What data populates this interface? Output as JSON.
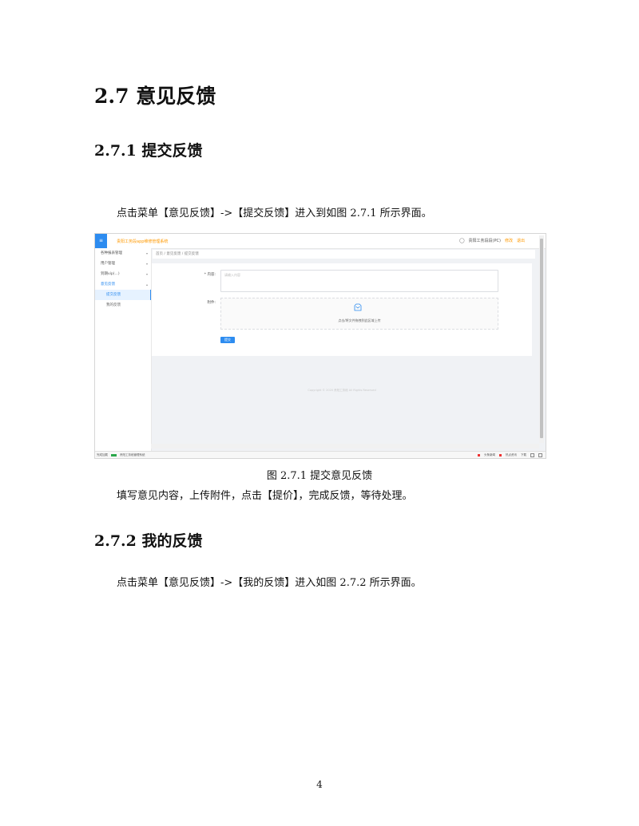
{
  "doc": {
    "section_title": "2.7 意见反馈",
    "sub1_title": "2.7.1  提交反馈",
    "sub1_intro": "点击菜单【意见反馈】->【提交反馈】进入到如图 2.7.1 所示界面。",
    "figure_caption": "图 2.7.1  提交意见反馈",
    "sub1_desc": "填写意见内容，上传附件，点击【提价】，完成反馈，等待处理。",
    "sub2_title": "2.7.2  我的反馈",
    "sub2_intro": "点击菜单【意见反馈】->【我的反馈】进入如图 2.7.2 所示界面。",
    "page_number": "4"
  },
  "shot": {
    "menu_icon": "≡",
    "app_title": "贵阳工务段app维修管理系统",
    "user_name": "贵阳工务段段(PC)",
    "user_link": "修改",
    "logout_link": "退出",
    "sidebar": [
      {
        "label": "各种报表管理",
        "open": false
      },
      {
        "label": "用户管理",
        "open": false
      },
      {
        "label": "到期vip(...)",
        "open": false
      },
      {
        "label": "意见反馈",
        "open": true
      }
    ],
    "sidebar_sub": [
      {
        "label": "提交反馈",
        "active": true
      },
      {
        "label": "我的反馈",
        "active": false
      }
    ],
    "breadcrumb": "首页 / 意见反馈 / 提交反馈",
    "form": {
      "content_label": "* 内容:",
      "content_placeholder": "请输入内容",
      "attach_label": "附件:",
      "upload_text": "点击/将文件拖拽到此区域上传",
      "submit_label": "提交"
    },
    "footer_note": "Copyright © 2020 贵阳工务段 All Rights Reserved",
    "status_left": {
      "label": "完成加载",
      "site": "贵阳工务段管理系统"
    },
    "status_right": {
      "item1": "头条新闻",
      "item2": "热点资讯",
      "item3": "下载"
    },
    "colors": {
      "accent": "#2d8cf0",
      "brand": "#ff9900"
    }
  }
}
